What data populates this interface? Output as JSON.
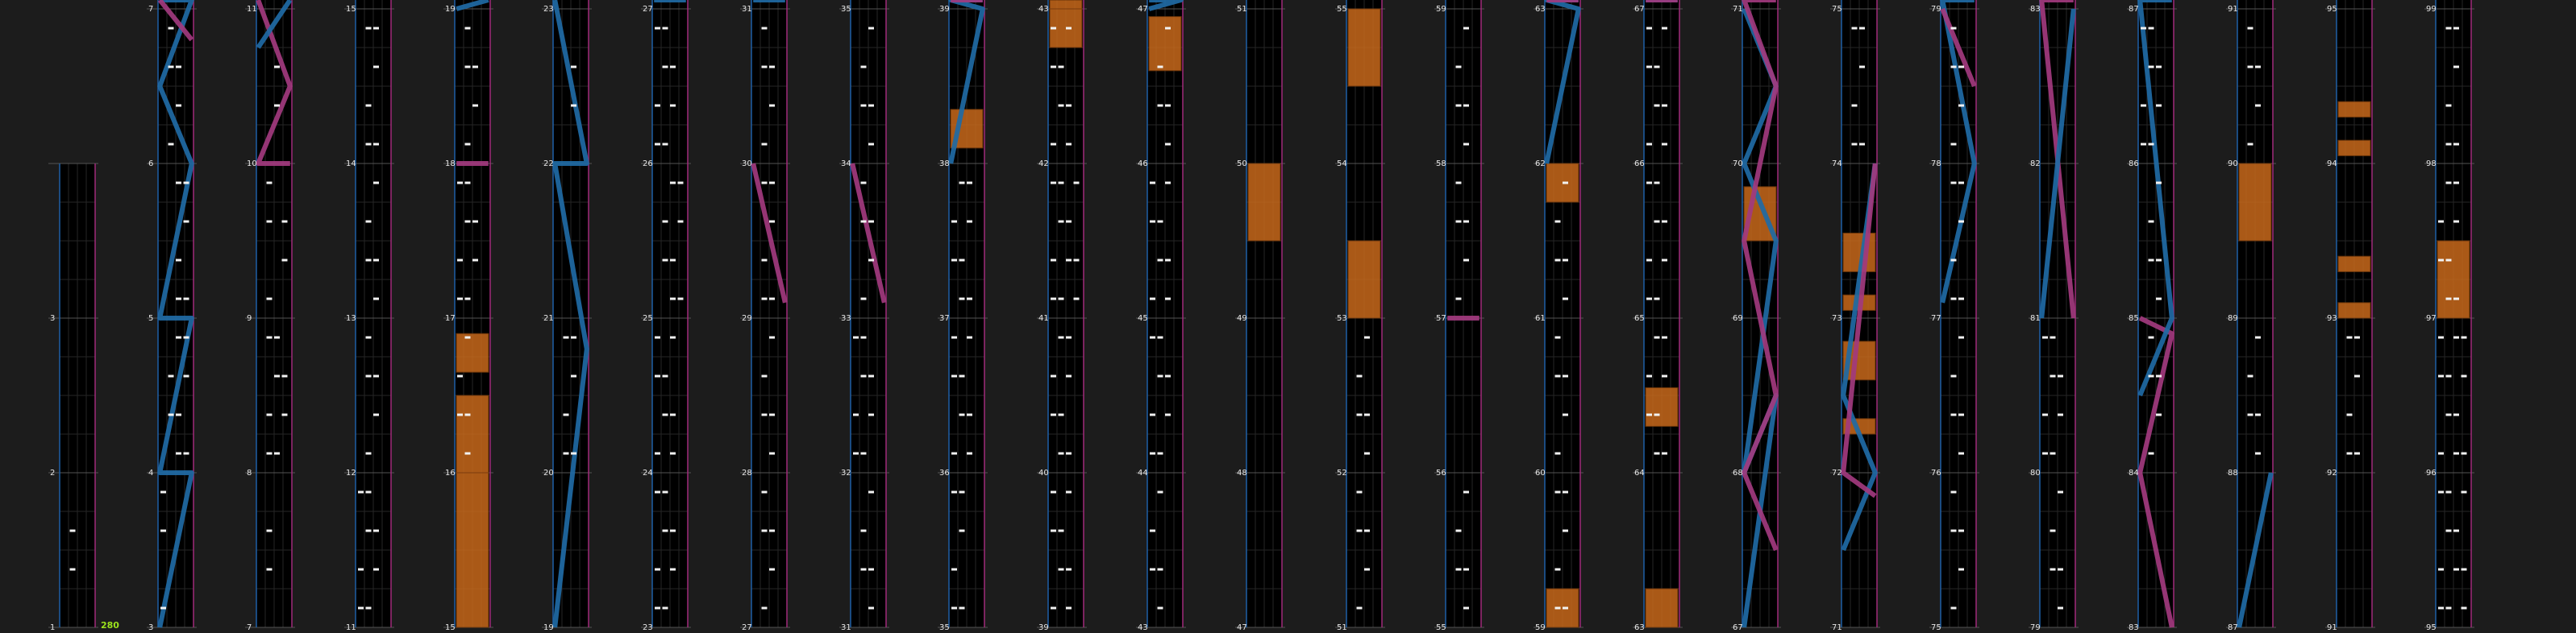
{
  "colors": {
    "background": "#1c1c1c",
    "lane": "#000000",
    "grid": "#262626",
    "bar_line": "#555555",
    "left_edge": "#1e5fa6",
    "right_edge": "#a02a7a",
    "left_slider": "#1f6aa5",
    "right_slider": "#a23a7e",
    "hold": "#c8691c",
    "note": "#f2f2f2",
    "text": "#e6e6e6",
    "combo": "#9be21c"
  },
  "combo": "280",
  "column_labels": [
    [
      "1",
      "2",
      "3"
    ],
    [
      "3",
      "4",
      "5",
      "6",
      "7"
    ],
    [
      "7",
      "8",
      "9",
      "10",
      "11"
    ],
    [
      "11",
      "12",
      "13",
      "14",
      "15"
    ],
    [
      "15",
      "16",
      "17",
      "18",
      "19"
    ],
    [
      "19",
      "20",
      "21",
      "22",
      "23"
    ],
    [
      "23",
      "24",
      "25",
      "26",
      "27"
    ],
    [
      "27",
      "28",
      "29",
      "30",
      "31"
    ],
    [
      "31",
      "32",
      "33",
      "34",
      "35"
    ],
    [
      "35",
      "36",
      "37",
      "38",
      "39"
    ],
    [
      "39",
      "40",
      "41",
      "42",
      "43"
    ],
    [
      "43",
      "44",
      "45",
      "46",
      "47"
    ],
    [
      "47",
      "48",
      "49",
      "50",
      "51"
    ],
    [
      "51",
      "52",
      "53",
      "54",
      "55"
    ],
    [
      "55",
      "56",
      "57",
      "58",
      "59"
    ],
    [
      "59",
      "60",
      "61",
      "62",
      "63"
    ],
    [
      "63",
      "64",
      "65",
      "66",
      "67"
    ],
    [
      "67",
      "68",
      "69",
      "70",
      "71"
    ],
    [
      "71",
      "72",
      "73",
      "74",
      "75"
    ],
    [
      "75",
      "76",
      "77",
      "78",
      "79"
    ],
    [
      "79",
      "80",
      "81",
      "82",
      "83"
    ],
    [
      "83",
      "84",
      "85",
      "86",
      "87"
    ],
    [
      "87",
      "88",
      "89",
      "90",
      "91"
    ],
    [
      "91",
      "92",
      "93",
      "94",
      "95"
    ],
    [
      "95",
      "96",
      "97",
      "98",
      "99"
    ]
  ],
  "holds": [
    {
      "col": 3,
      "m": 15,
      "from": 0.95,
      "to": 1.0
    },
    {
      "col": 4,
      "m": 16,
      "from": 0.0,
      "to": 0.5
    },
    {
      "col": 4,
      "m": 16,
      "from": 0.65,
      "to": 0.9
    },
    {
      "col": 4,
      "m": 15,
      "from": 0.0,
      "to": 1.0
    },
    {
      "col": 8,
      "m": 35,
      "from": 0.6,
      "to": 0.85
    },
    {
      "col": 8,
      "m": 35,
      "from": 0.9,
      "to": 1.0
    },
    {
      "col": 9,
      "m": 38,
      "from": 0.1,
      "to": 0.35
    },
    {
      "col": 10,
      "m": 43,
      "from": 0.5,
      "to": 1.0
    },
    {
      "col": 10,
      "m": 43,
      "from": 0.0,
      "to": 0.2
    },
    {
      "col": 10,
      "m": 42,
      "from": 0.75,
      "to": 1.0
    },
    {
      "col": 11,
      "m": 46,
      "from": 0.6,
      "to": 0.95
    },
    {
      "col": 12,
      "m": 49,
      "from": 0.5,
      "to": 1.0
    },
    {
      "col": 13,
      "m": 54,
      "from": 0.5,
      "to": 1.0
    },
    {
      "col": 13,
      "m": 53,
      "from": 0.0,
      "to": 0.5
    },
    {
      "col": 14,
      "m": 59,
      "from": 0.9,
      "to": 1.0
    },
    {
      "col": 15,
      "m": 63,
      "from": 0.9,
      "to": 1.0
    },
    {
      "col": 15,
      "m": 61,
      "from": 0.75,
      "to": 1.0
    },
    {
      "col": 15,
      "m": 59,
      "from": 0.0,
      "to": 0.25
    },
    {
      "col": 16,
      "m": 67,
      "from": 0.35,
      "to": 0.6
    },
    {
      "col": 16,
      "m": 64,
      "from": 0.3,
      "to": 0.55
    },
    {
      "col": 16,
      "m": 63,
      "from": 0.0,
      "to": 0.25
    },
    {
      "col": 17,
      "m": 69,
      "from": 0.5,
      "to": 0.85
    },
    {
      "col": 18,
      "m": 73,
      "from": 0.3,
      "to": 0.55
    },
    {
      "col": 18,
      "m": 73,
      "from": 0.05,
      "to": 0.15
    },
    {
      "col": 18,
      "m": 72,
      "from": 0.6,
      "to": 0.85
    },
    {
      "col": 18,
      "m": 72,
      "from": 0.25,
      "to": 0.35
    },
    {
      "col": 22,
      "m": 85,
      "from": 0.5,
      "to": 1.0
    },
    {
      "col": 22,
      "m": 89,
      "from": 0.5,
      "to": 1.0
    },
    {
      "col": 23,
      "m": 94,
      "from": 0.3,
      "to": 0.4
    },
    {
      "col": 23,
      "m": 94,
      "from": 0.05,
      "to": 0.15
    },
    {
      "col": 23,
      "m": 93,
      "from": 0.3,
      "to": 0.4
    },
    {
      "col": 23,
      "m": 93,
      "from": 0.0,
      "to": 0.1
    },
    {
      "col": 24,
      "m": 97,
      "from": 0.0,
      "to": 0.5
    }
  ],
  "sliders": [
    {
      "col": 1,
      "side": "L",
      "pts": [
        [
          3,
          0
        ],
        [
          3,
          1
        ],
        [
          4,
          0
        ],
        [
          4,
          1
        ],
        [
          5,
          0
        ],
        [
          6,
          0
        ],
        [
          6,
          0.5
        ],
        [
          7,
          0.5
        ],
        [
          7,
          1
        ]
      ]
    },
    {
      "col": 1,
      "side": "R",
      "pts": [
        [
          6,
          0.8
        ],
        [
          7,
          0.8
        ]
      ]
    },
    {
      "col": 2,
      "side": "R",
      "pts": [
        [
          9,
          1
        ],
        [
          10,
          0
        ],
        [
          10,
          0.5
        ],
        [
          11,
          0.5
        ]
      ]
    },
    {
      "col": 2,
      "side": "L",
      "pts": [
        [
          10,
          0.75
        ],
        [
          11,
          0.75
        ]
      ]
    },
    {
      "col": 4,
      "side": "R",
      "pts": [
        [
          17,
          1
        ],
        [
          18,
          0
        ]
      ]
    },
    {
      "col": 4,
      "side": "L",
      "pts": [
        [
          19,
          0
        ],
        [
          19,
          0.1
        ]
      ]
    },
    {
      "col": 5,
      "side": "L",
      "pts": [
        [
          19,
          0
        ],
        [
          20,
          0.8
        ],
        [
          21,
          1
        ],
        [
          22,
          0
        ],
        [
          23,
          1
        ]
      ]
    },
    {
      "col": 6,
      "side": "L",
      "pts": [
        [
          27,
          0.1
        ],
        [
          27,
          1
        ]
      ]
    },
    {
      "col": 7,
      "side": "L",
      "pts": [
        [
          31,
          0.1
        ],
        [
          31,
          1
        ]
      ]
    },
    {
      "col": 7,
      "side": "R",
      "pts": [
        [
          29,
          0.1
        ],
        [
          29,
          1
        ]
      ]
    },
    {
      "col": 8,
      "side": "R",
      "pts": [
        [
          33,
          0.1
        ],
        [
          33,
          1
        ]
      ]
    },
    {
      "col": 9,
      "side": "L",
      "pts": [
        [
          38,
          0
        ],
        [
          38,
          1
        ],
        [
          39,
          0.5
        ],
        [
          39,
          1
        ]
      ]
    },
    {
      "col": 9,
      "side": "R",
      "pts": [
        [
          39,
          0.25
        ],
        [
          39,
          1
        ]
      ]
    },
    {
      "col": 11,
      "side": "L",
      "pts": [
        [
          47,
          0
        ],
        [
          48,
          0.8
        ],
        [
          49,
          1
        ]
      ]
    },
    {
      "col": 14,
      "side": "R",
      "pts": [
        [
          56,
          1
        ],
        [
          57,
          0
        ]
      ]
    },
    {
      "col": 15,
      "side": "L",
      "pts": [
        [
          62,
          0
        ],
        [
          62,
          1
        ],
        [
          63,
          0.5
        ],
        [
          63,
          1
        ]
      ]
    },
    {
      "col": 15,
      "side": "R",
      "pts": [
        [
          63,
          0.25
        ],
        [
          63,
          1
        ]
      ]
    },
    {
      "col": 16,
      "side": "L",
      "pts": [
        [
          67,
          0.8
        ],
        [
          67,
          1
        ]
      ]
    },
    {
      "col": 16,
      "side": "R",
      "pts": [
        [
          67,
          1
        ],
        [
          67,
          0.9
        ]
      ]
    },
    {
      "col": 17,
      "side": "L",
      "pts": [
        [
          67,
          0
        ],
        [
          68,
          0.5
        ],
        [
          68,
          0
        ],
        [
          69,
          0.5
        ],
        [
          70,
          0
        ],
        [
          70,
          0.5
        ],
        [
          71,
          0
        ]
      ]
    },
    {
      "col": 17,
      "side": "R",
      "pts": [
        [
          67,
          0.5
        ],
        [
          68,
          0
        ],
        [
          68,
          0.5
        ],
        [
          69,
          0.5
        ],
        [
          70,
          0.5
        ],
        [
          71,
          0.5
        ],
        [
          71,
          1
        ]
      ]
    },
    {
      "col": 18,
      "side": "L",
      "pts": [
        [
          71,
          0.5
        ],
        [
          72,
          0
        ],
        [
          72,
          0.5
        ],
        [
          73,
          1
        ]
      ]
    },
    {
      "col": 18,
      "side": "R",
      "pts": [
        [
          71,
          0.85
        ],
        [
          71,
          1
        ],
        [
          73,
          1
        ]
      ]
    },
    {
      "col": 19,
      "side": "L",
      "pts": [
        [
          77,
          0.1
        ],
        [
          77,
          1
        ],
        [
          79,
          0.1
        ],
        [
          79,
          1
        ]
      ]
    },
    {
      "col": 19,
      "side": "R",
      "pts": [
        [
          78,
          0.5
        ],
        [
          78,
          1
        ]
      ]
    },
    {
      "col": 20,
      "side": "R",
      "pts": [
        [
          81,
          0
        ],
        [
          83,
          0.3
        ],
        [
          83,
          1
        ]
      ]
    },
    {
      "col": 20,
      "side": "L",
      "pts": [
        [
          81,
          0
        ],
        [
          82,
          1
        ]
      ]
    },
    {
      "col": 21,
      "side": "R",
      "pts": [
        [
          83,
          0
        ],
        [
          83,
          1
        ],
        [
          84,
          0.9
        ],
        [
          84,
          1
        ]
      ]
    },
    {
      "col": 21,
      "side": "L",
      "pts": [
        [
          84,
          0.5
        ],
        [
          84,
          1
        ],
        [
          87,
          0.5
        ],
        [
          87,
          1
        ]
      ]
    },
    {
      "col": 22,
      "side": "L",
      "pts": [
        [
          87,
          0
        ],
        [
          87,
          1
        ]
      ]
    }
  ],
  "notes": [
    {
      "col": 0,
      "m": 1,
      "lanes": [
        1
      ]
    },
    {
      "col": 1,
      "m": 3,
      "lanes": [
        0
      ]
    },
    {
      "col": 1,
      "m": 4,
      "lanes": [
        1,
        2,
        3
      ]
    },
    {
      "col": 1,
      "m": 5,
      "lanes": [
        2,
        3
      ]
    },
    {
      "col": 1,
      "m": 6,
      "lanes": [
        1,
        2
      ]
    },
    {
      "col": 1,
      "m": 7,
      "lanes": [
        2,
        3
      ]
    },
    {
      "col": 2,
      "m": 7,
      "lanes": [
        1
      ]
    },
    {
      "col": 2,
      "m": 8,
      "lanes": [
        1,
        2,
        3
      ]
    },
    {
      "col": 2,
      "m": 9,
      "lanes": [
        1,
        3
      ]
    },
    {
      "col": 2,
      "m": 10,
      "lanes": [
        2
      ]
    },
    {
      "col": 2,
      "m": 11,
      "lanes": [
        2,
        3
      ]
    },
    {
      "col": 3,
      "m": 11,
      "lanes": [
        0,
        1,
        2
      ]
    },
    {
      "col": 3,
      "m": 12,
      "lanes": [
        1,
        2
      ]
    },
    {
      "col": 3,
      "m": 13,
      "lanes": [
        1,
        2
      ]
    },
    {
      "col": 3,
      "m": 14,
      "lanes": [
        1,
        2
      ]
    },
    {
      "col": 3,
      "m": 15,
      "lanes": [
        1,
        2
      ]
    },
    {
      "col": 4,
      "m": 16,
      "lanes": [
        0,
        1
      ]
    },
    {
      "col": 4,
      "m": 17,
      "lanes": [
        0,
        1,
        2
      ]
    },
    {
      "col": 4,
      "m": 18,
      "lanes": [
        1,
        2
      ]
    },
    {
      "col": 4,
      "m": 19,
      "lanes": [
        1,
        2
      ]
    },
    {
      "col": 5,
      "m": 20,
      "lanes": [
        1,
        2
      ]
    },
    {
      "col": 5,
      "m": 22,
      "lanes": [
        2
      ]
    },
    {
      "col": 6,
      "m": 23,
      "lanes": [
        0,
        1,
        2
      ]
    },
    {
      "col": 6,
      "m": 24,
      "lanes": [
        0,
        1,
        2
      ]
    },
    {
      "col": 6,
      "m": 25,
      "lanes": [
        1,
        2,
        3
      ]
    },
    {
      "col": 6,
      "m": 26,
      "lanes": [
        0,
        1,
        2
      ]
    },
    {
      "col": 6,
      "m": 27,
      "lanes": [
        1,
        2
      ]
    },
    {
      "col": 7,
      "m": 27,
      "lanes": [
        1,
        2
      ]
    },
    {
      "col": 7,
      "m": 28,
      "lanes": [
        1,
        2
      ]
    },
    {
      "col": 7,
      "m": 29,
      "lanes": [
        1,
        2
      ]
    },
    {
      "col": 7,
      "m": 30,
      "lanes": [
        1,
        2
      ]
    },
    {
      "col": 7,
      "m": 31,
      "lanes": [
        1,
        2
      ]
    },
    {
      "col": 8,
      "m": 31,
      "lanes": [
        1,
        2
      ]
    },
    {
      "col": 8,
      "m": 32,
      "lanes": [
        0,
        1,
        2
      ]
    },
    {
      "col": 8,
      "m": 33,
      "lanes": [
        1,
        2
      ]
    },
    {
      "col": 8,
      "m": 34,
      "lanes": [
        1,
        2
      ]
    },
    {
      "col": 9,
      "m": 35,
      "lanes": [
        0,
        1
      ]
    },
    {
      "col": 9,
      "m": 36,
      "lanes": [
        0,
        1,
        2
      ]
    },
    {
      "col": 9,
      "m": 37,
      "lanes": [
        0,
        1,
        2
      ]
    },
    {
      "col": 9,
      "m": 39,
      "lanes": [
        1,
        2
      ]
    },
    {
      "col": 10,
      "m": 39,
      "lanes": [
        0,
        1,
        2
      ]
    },
    {
      "col": 10,
      "m": 40,
      "lanes": [
        0,
        1,
        2
      ]
    },
    {
      "col": 10,
      "m": 41,
      "lanes": [
        0,
        1,
        2,
        3
      ]
    },
    {
      "col": 10,
      "m": 42,
      "lanes": [
        0,
        1,
        2
      ]
    },
    {
      "col": 11,
      "m": 43,
      "lanes": [
        0,
        1
      ]
    },
    {
      "col": 11,
      "m": 44,
      "lanes": [
        0,
        1,
        2
      ]
    },
    {
      "col": 11,
      "m": 45,
      "lanes": [
        0,
        1,
        2
      ]
    },
    {
      "col": 11,
      "m": 46,
      "lanes": [
        1,
        2
      ]
    },
    {
      "col": 11,
      "m": 47,
      "lanes": [
        1,
        2
      ]
    },
    {
      "col": 13,
      "m": 51,
      "lanes": [
        1,
        2
      ]
    },
    {
      "col": 13,
      "m": 52,
      "lanes": [
        1,
        2
      ]
    },
    {
      "col": 13,
      "m": 55,
      "lanes": [
        1,
        2
      ]
    },
    {
      "col": 14,
      "m": 55,
      "lanes": [
        1,
        2
      ]
    },
    {
      "col": 14,
      "m": 57,
      "lanes": [
        1,
        2
      ]
    },
    {
      "col": 14,
      "m": 58,
      "lanes": [
        1,
        2
      ]
    },
    {
      "col": 15,
      "m": 59,
      "lanes": [
        1,
        2
      ]
    },
    {
      "col": 15,
      "m": 60,
      "lanes": [
        1,
        2
      ]
    },
    {
      "col": 15,
      "m": 61,
      "lanes": [
        1,
        2
      ]
    },
    {
      "col": 16,
      "m": 64,
      "lanes": [
        0,
        1,
        2
      ]
    },
    {
      "col": 16,
      "m": 65,
      "lanes": [
        0,
        1,
        2
      ]
    },
    {
      "col": 16,
      "m": 66,
      "lanes": [
        0,
        1,
        2
      ]
    },
    {
      "col": 16,
      "m": 67,
      "lanes": [
        1,
        2
      ]
    },
    {
      "col": 18,
      "m": 74,
      "lanes": [
        1,
        2
      ]
    },
    {
      "col": 18,
      "m": 75,
      "lanes": [
        0,
        1,
        2
      ]
    },
    {
      "col": 19,
      "m": 75,
      "lanes": [
        1,
        2
      ]
    },
    {
      "col": 19,
      "m": 76,
      "lanes": [
        1,
        2
      ]
    },
    {
      "col": 19,
      "m": 77,
      "lanes": [
        1,
        2
      ]
    },
    {
      "col": 19,
      "m": 78,
      "lanes": [
        1,
        2
      ]
    },
    {
      "col": 20,
      "m": 79,
      "lanes": [
        1,
        2
      ]
    },
    {
      "col": 20,
      "m": 80,
      "lanes": [
        0,
        1,
        2
      ]
    },
    {
      "col": 21,
      "m": 84,
      "lanes": [
        1,
        2
      ]
    },
    {
      "col": 21,
      "m": 85,
      "lanes": [
        1,
        2
      ]
    },
    {
      "col": 21,
      "m": 86,
      "lanes": [
        0,
        1,
        2
      ]
    },
    {
      "col": 21,
      "m": 87,
      "lanes": [
        0,
        1,
        2
      ]
    },
    {
      "col": 22,
      "m": 88,
      "lanes": [
        1,
        2
      ]
    },
    {
      "col": 22,
      "m": 90,
      "lanes": [
        1,
        2
      ]
    },
    {
      "col": 22,
      "m": 91,
      "lanes": [
        1,
        2
      ]
    },
    {
      "col": 23,
      "m": 92,
      "lanes": [
        1,
        2
      ]
    },
    {
      "col": 23,
      "m": 95,
      "lanes": [
        1,
        2
      ]
    },
    {
      "col": 24,
      "m": 95,
      "lanes": [
        0,
        1,
        2,
        3
      ]
    },
    {
      "col": 24,
      "m": 96,
      "lanes": [
        0,
        1,
        2,
        3
      ]
    },
    {
      "col": 24,
      "m": 97,
      "lanes": [
        0,
        1,
        2
      ]
    },
    {
      "col": 24,
      "m": 98,
      "lanes": [
        1,
        2
      ]
    },
    {
      "col": 24,
      "m": 99,
      "lanes": [
        1,
        2
      ]
    }
  ]
}
